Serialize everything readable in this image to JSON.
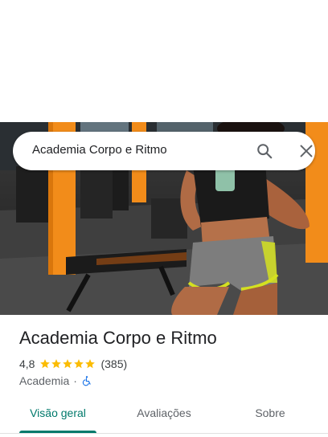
{
  "search": {
    "query": "Academia Corpo e Ritmo",
    "search_icon": "search-icon",
    "close_icon": "close-icon"
  },
  "place": {
    "name": "Academia Corpo e Ritmo",
    "rating": "4,8",
    "rating_value": 4.8,
    "stars": 5,
    "review_count": "(385)",
    "category": "Academia",
    "separator": "·",
    "accessibility_icon": "wheelchair-accessible-icon"
  },
  "tabs": [
    {
      "label": "Visão geral",
      "active": true
    },
    {
      "label": "Avaliações",
      "active": false
    },
    {
      "label": "Sobre",
      "active": false
    }
  ],
  "colors": {
    "accent": "#00796b",
    "star": "#fbbc04",
    "accessibility": "#1a73e8",
    "pillar": "#f28c1a",
    "shorts_trim": "#d4e020"
  }
}
